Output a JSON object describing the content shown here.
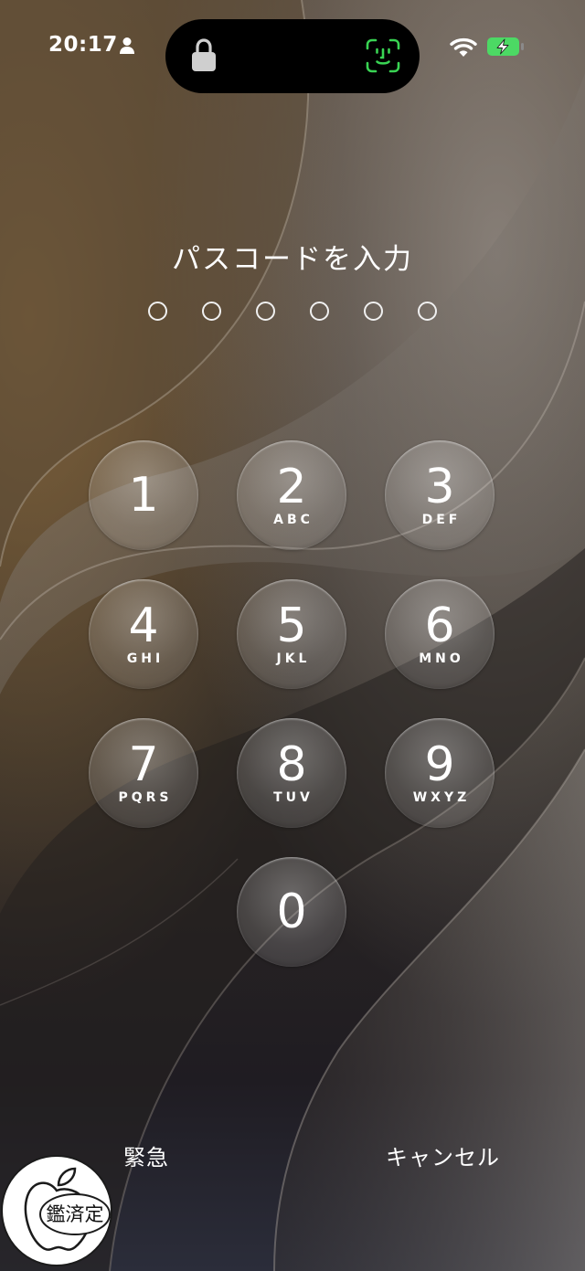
{
  "status_bar": {
    "time": "20:17",
    "icons": [
      "person-icon",
      "wifi-icon",
      "battery-charging-icon"
    ],
    "battery_color": "#4cd964"
  },
  "dynamic_island": {
    "left_icon": "lock-icon",
    "right_icon": "face-id-icon",
    "faceid_color": "#39d353"
  },
  "passcode": {
    "prompt": "パスコードを入力",
    "length": 6,
    "entered": 0
  },
  "keypad": [
    {
      "digit": "1",
      "letters": ""
    },
    {
      "digit": "2",
      "letters": "ABC"
    },
    {
      "digit": "3",
      "letters": "DEF"
    },
    {
      "digit": "4",
      "letters": "GHI"
    },
    {
      "digit": "5",
      "letters": "JKL"
    },
    {
      "digit": "6",
      "letters": "MNO"
    },
    {
      "digit": "7",
      "letters": "PQRS"
    },
    {
      "digit": "8",
      "letters": "TUV"
    },
    {
      "digit": "9",
      "letters": "WXYZ"
    },
    {
      "digit": "0",
      "letters": ""
    }
  ],
  "actions": {
    "emergency": "緊急",
    "cancel": "キャンセル"
  },
  "watermark": {
    "icon": "apple-logo-icon",
    "text": "鑑済定"
  }
}
